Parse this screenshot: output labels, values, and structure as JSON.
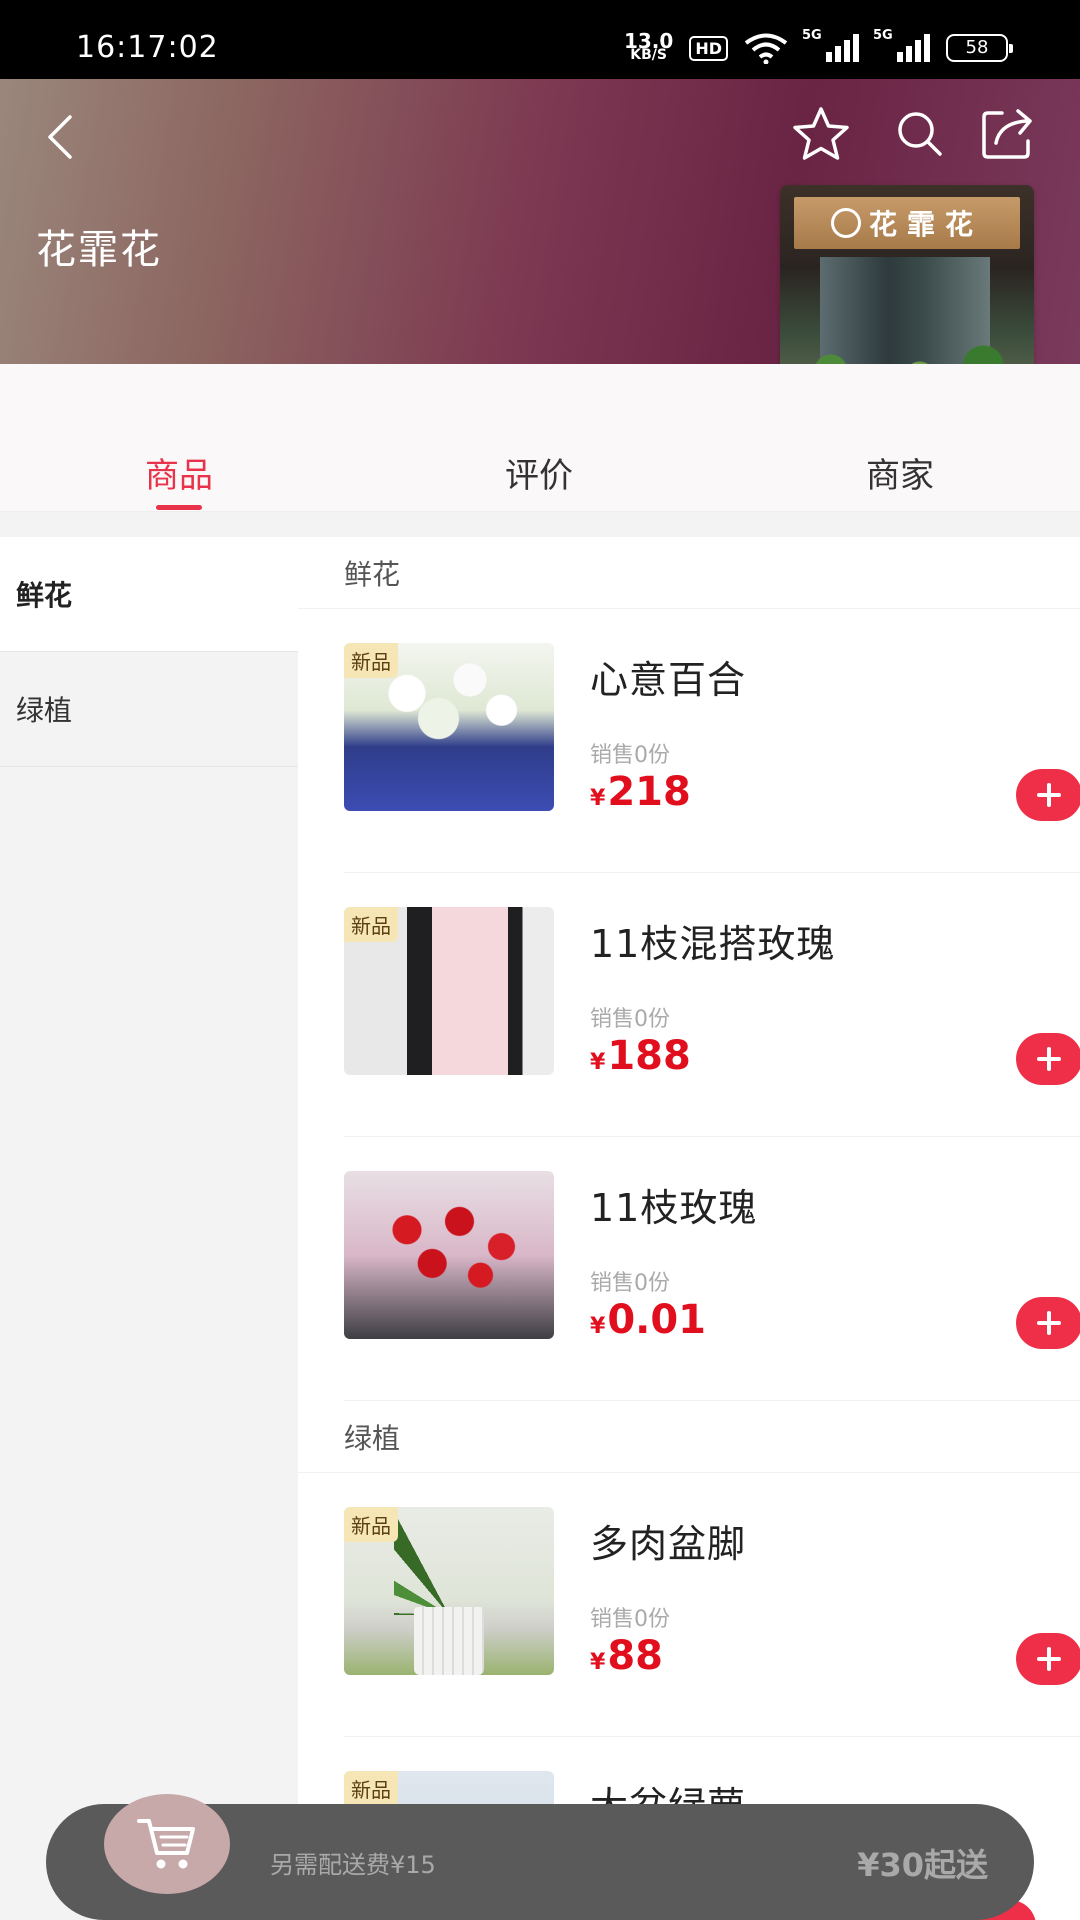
{
  "status_bar": {
    "time": "16:17:02",
    "net_speed_value": "13.0",
    "net_speed_unit": "KB/S",
    "hd_label": "HD",
    "signal1_label": "5G",
    "signal2_label": "5G",
    "battery": "58"
  },
  "store": {
    "name": "花霏花",
    "photo_sign_text": "花霏花"
  },
  "tabs": [
    {
      "label": "商品",
      "active": true
    },
    {
      "label": "评价",
      "active": false
    },
    {
      "label": "商家",
      "active": false
    }
  ],
  "sidebar": {
    "items": [
      {
        "label": "鲜花",
        "active": true
      },
      {
        "label": "绿植",
        "active": false
      }
    ]
  },
  "sections": [
    {
      "title": "鲜花",
      "products": [
        {
          "name": "心意百合",
          "sales": "销售0份",
          "currency": "¥",
          "price": "218",
          "badge": "新品"
        },
        {
          "name": "11枝混搭玫瑰",
          "sales": "销售0份",
          "currency": "¥",
          "price": "188",
          "badge": "新品"
        },
        {
          "name": "11枝玫瑰",
          "sales": "销售0份",
          "currency": "¥",
          "price": "0.01",
          "badge": ""
        }
      ]
    },
    {
      "title": "绿植",
      "products": [
        {
          "name": "多肉盆脚",
          "sales": "销售0份",
          "currency": "¥",
          "price": "88",
          "badge": "新品"
        },
        {
          "name": "大盆绿萝",
          "badge": "新品"
        }
      ]
    }
  ],
  "cart": {
    "delivery_fee": "另需配送费¥15",
    "min_order": "¥30起送"
  },
  "colors": {
    "accent": "#e8334a",
    "price": "#e10f1d",
    "add_button": "#ef2f48",
    "cart_bar": "#5b5a5a"
  },
  "icons": {
    "back": "chevron-left-icon",
    "favorite": "star-icon",
    "search": "search-icon",
    "share": "share-icon",
    "add": "plus-icon",
    "cart": "cart-icon"
  }
}
